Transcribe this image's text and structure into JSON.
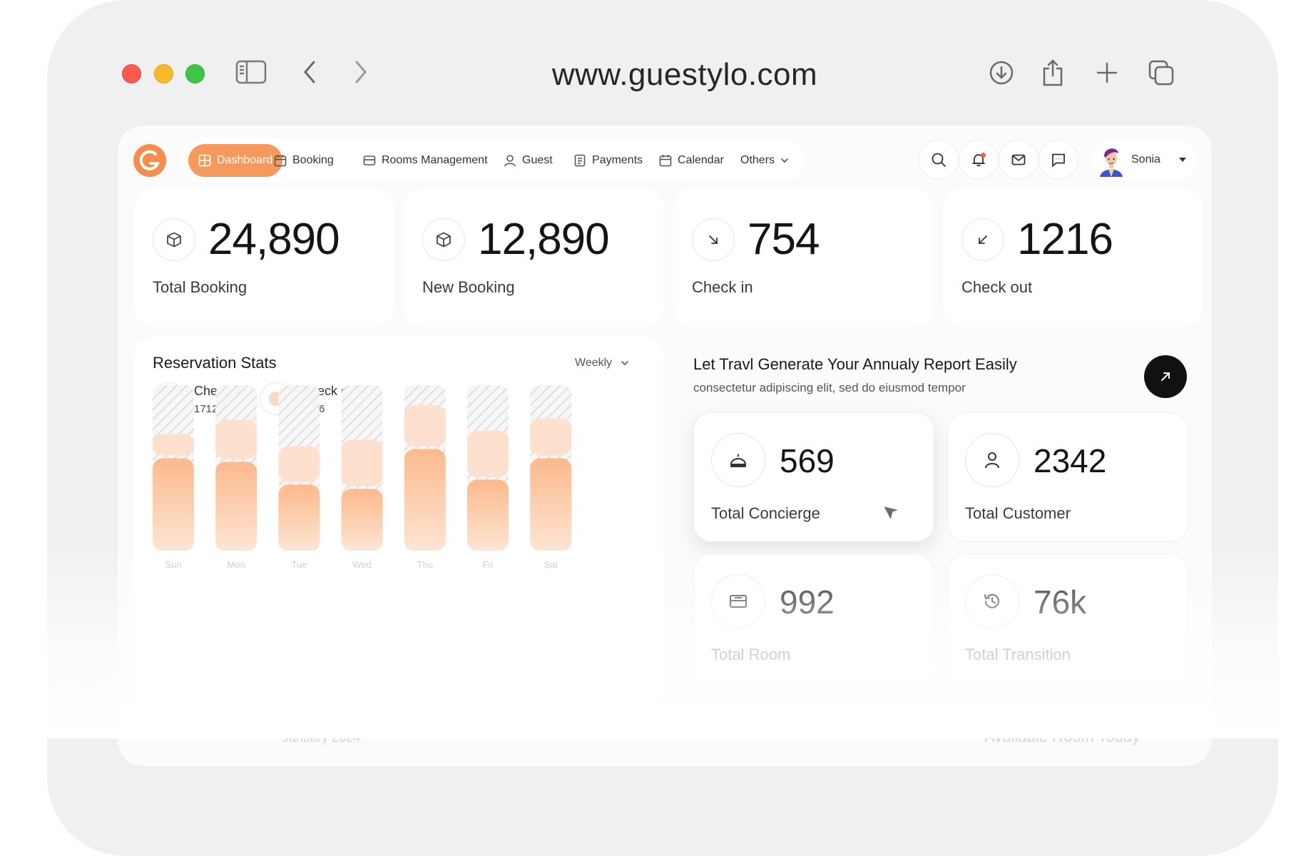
{
  "browser": {
    "url": "www.guestylo.com",
    "traffic_lights": [
      "#fa5a4f",
      "#f8b92c",
      "#3fc448"
    ],
    "toolbar_icons": [
      "sidebar-icon",
      "back-icon",
      "forward-icon",
      "download-icon",
      "share-icon",
      "new-tab-icon",
      "tabs-overview-icon"
    ]
  },
  "nav": {
    "items": [
      {
        "label": "Dashboard",
        "icon": "grid-icon",
        "active": true
      },
      {
        "label": "Booking",
        "icon": "calendar-icon"
      },
      {
        "label": "Rooms Management",
        "icon": "bed-icon"
      },
      {
        "label": "Guest",
        "icon": "user-icon"
      },
      {
        "label": "Payments",
        "icon": "receipt-icon"
      },
      {
        "label": "Calendar",
        "icon": "calendar-icon"
      },
      {
        "label": "Others",
        "icon": "chevron-down-icon"
      }
    ],
    "accent": "#f59a5c"
  },
  "header": {
    "icons": [
      "search-icon",
      "bell-icon",
      "mail-icon",
      "chat-icon"
    ],
    "user": {
      "name": "Sonia"
    }
  },
  "stats": [
    {
      "value": "24,890",
      "label": "Total Booking",
      "icon": "box-icon"
    },
    {
      "value": "12,890",
      "label": "New Booking",
      "icon": "box-icon"
    },
    {
      "value": "754",
      "label": "Check in",
      "icon": "arrow-down-right-icon"
    },
    {
      "value": "1216",
      "label": "Check out",
      "icon": "arrow-down-left-icon"
    }
  ],
  "reservation": {
    "title": "Reservation Stats",
    "period": "Weekly",
    "legend": [
      {
        "label": "Check in",
        "value": "1712",
        "color": "#f7a069"
      },
      {
        "label": "Check out",
        "value": "1216",
        "color": "#fcd9c2"
      }
    ]
  },
  "chart_data": {
    "type": "bar",
    "stacked": true,
    "categories": [
      "Sun",
      "Mon",
      "Tue",
      "Wed",
      "Thu",
      "Fri",
      "Sat"
    ],
    "series": [
      {
        "name": "Check in",
        "values": [
          130,
          125,
          93,
          87,
          143,
          100,
          130
        ]
      },
      {
        "name": "Check out",
        "values": [
          30,
          55,
          50,
          65,
          58,
          65,
          52
        ]
      }
    ],
    "capacity": 233
  },
  "report": {
    "title": "Let Travl Generate Your Annualy Report Easily",
    "subtitle": "consectetur adipiscing elit, sed do eiusmod tempor",
    "button_icon": "arrow-up-right-icon"
  },
  "summary": [
    {
      "value": "569",
      "label": "Total Concierge",
      "icon": "concierge-bell-icon"
    },
    {
      "value": "2342",
      "label": "Total Customer",
      "icon": "user-icon"
    },
    {
      "value": "992",
      "label": "Total Room",
      "icon": "bed-icon"
    },
    {
      "value": "76k",
      "label": "Total Transition",
      "icon": "history-icon"
    }
  ],
  "faded": {
    "calendar_month": "January 2024",
    "available_rooms": "Available Room Today"
  }
}
